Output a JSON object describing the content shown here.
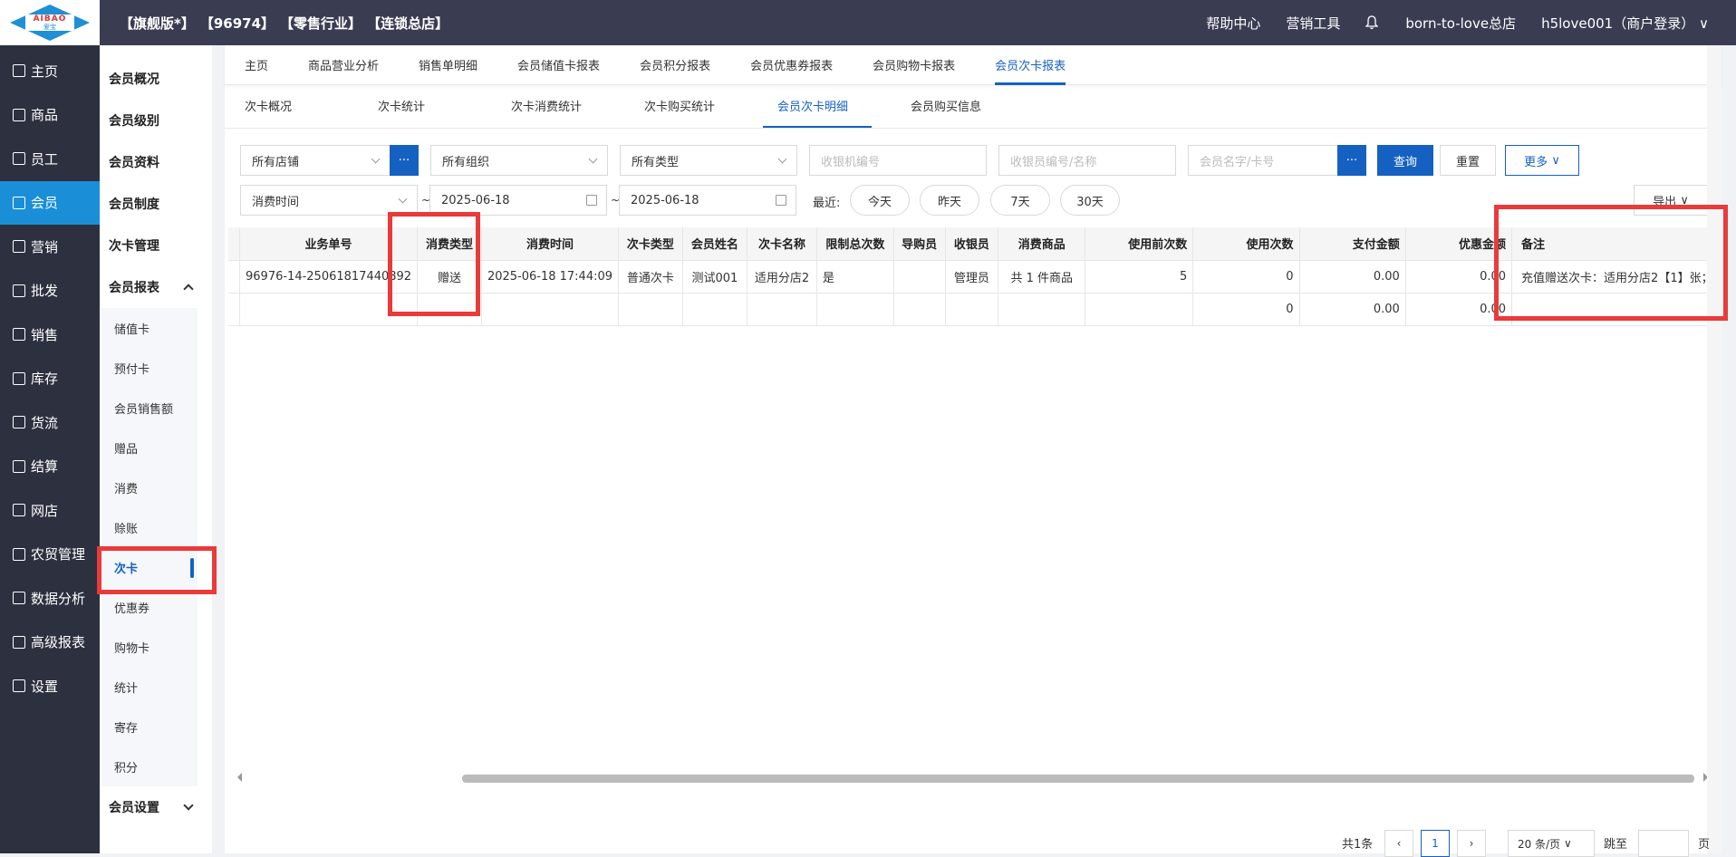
{
  "topbar": {
    "logo_en": "AIBAO",
    "logo_cn": "爱宝",
    "tags": [
      "【旗舰版*】",
      "【96974】",
      "【零售行业】",
      "【连锁总店】"
    ],
    "help": "帮助中心",
    "marketing_tools": "营销工具",
    "store": "born-to-love总店",
    "user": "h5love001（商户登录）"
  },
  "sidebar": {
    "items": [
      {
        "label": "主页",
        "icon": "home-icon"
      },
      {
        "label": "商品",
        "icon": "goods-icon"
      },
      {
        "label": "员工",
        "icon": "staff-icon"
      },
      {
        "label": "会员",
        "icon": "member-icon"
      },
      {
        "label": "营销",
        "icon": "megaphone-icon"
      },
      {
        "label": "批发",
        "icon": "wholesale-icon"
      },
      {
        "label": "销售",
        "icon": "chart-icon"
      },
      {
        "label": "库存",
        "icon": "stock-icon"
      },
      {
        "label": "货流",
        "icon": "flow-icon"
      },
      {
        "label": "结算",
        "icon": "settle-icon"
      },
      {
        "label": "网店",
        "icon": "shop-icon"
      },
      {
        "label": "农贸管理",
        "icon": "farm-icon"
      },
      {
        "label": "数据分析",
        "icon": "data-icon"
      },
      {
        "label": "高级报表",
        "icon": "report-icon"
      },
      {
        "label": "设置",
        "icon": "gear-icon"
      }
    ]
  },
  "subside": {
    "items": [
      "会员概况",
      "会员级别",
      "会员资料",
      "会员制度",
      "次卡管理"
    ],
    "reports_label": "会员报表",
    "report_children": [
      "储值卡",
      "预付卡",
      "会员销售额",
      "赠品",
      "消费",
      "赊账",
      "次卡",
      "优惠券",
      "购物卡",
      "统计",
      "寄存",
      "积分"
    ],
    "settings_label": "会员设置"
  },
  "tabs1": [
    "主页",
    "商品营业分析",
    "销售单明细",
    "会员储值卡报表",
    "会员积分报表",
    "会员优惠券报表",
    "会员购物卡报表",
    "会员次卡报表"
  ],
  "tabs2": [
    "次卡概况",
    "次卡统计",
    "次卡消费统计",
    "次卡购买统计",
    "会员次卡明细",
    "会员购买信息"
  ],
  "filters": {
    "store": "所有店铺",
    "org": "所有组织",
    "type": "所有类型",
    "cashier_machine_ph": "收银机编号",
    "cashier_ph": "收银员编号/名称",
    "member_ph": "会员名字/卡号",
    "more_btn": "···",
    "query": "查询",
    "reset": "重置",
    "more": "更多",
    "time_type": "消费时间",
    "date_from": "2025-06-18",
    "date_to": "2025-06-18",
    "tilde": "~",
    "recent": "最近:",
    "today": "今天",
    "yesterday": "昨天",
    "d7": "7天",
    "d30": "30天",
    "export": "导出"
  },
  "table": {
    "headers": [
      "业务单号",
      "消费类型",
      "消费时间",
      "次卡类型",
      "会员姓名",
      "次卡名称",
      "限制总次数",
      "导购员",
      "收银员",
      "消费商品",
      "使用前次数",
      "使用次数",
      "支付金额",
      "优惠金额",
      "备注"
    ],
    "row1": [
      "96976-14-25061817440892",
      "赠送",
      "2025-06-18 17:44:09",
      "普通次卡",
      "测试001",
      "适用分店2",
      "是",
      "",
      "管理员",
      "共  1  件商品",
      "5",
      "0",
      "0.00",
      "0.00",
      "充值赠送次卡：适用分店2【1】张；"
    ],
    "total": [
      "",
      "",
      "",
      "",
      "",
      "",
      "",
      "",
      "",
      "",
      "",
      "0",
      "0.00",
      "0.00",
      ""
    ]
  },
  "pager": {
    "total": "共1条",
    "page": "1",
    "size": "20 条/页",
    "goto": "跳至",
    "page_unit": "页"
  }
}
